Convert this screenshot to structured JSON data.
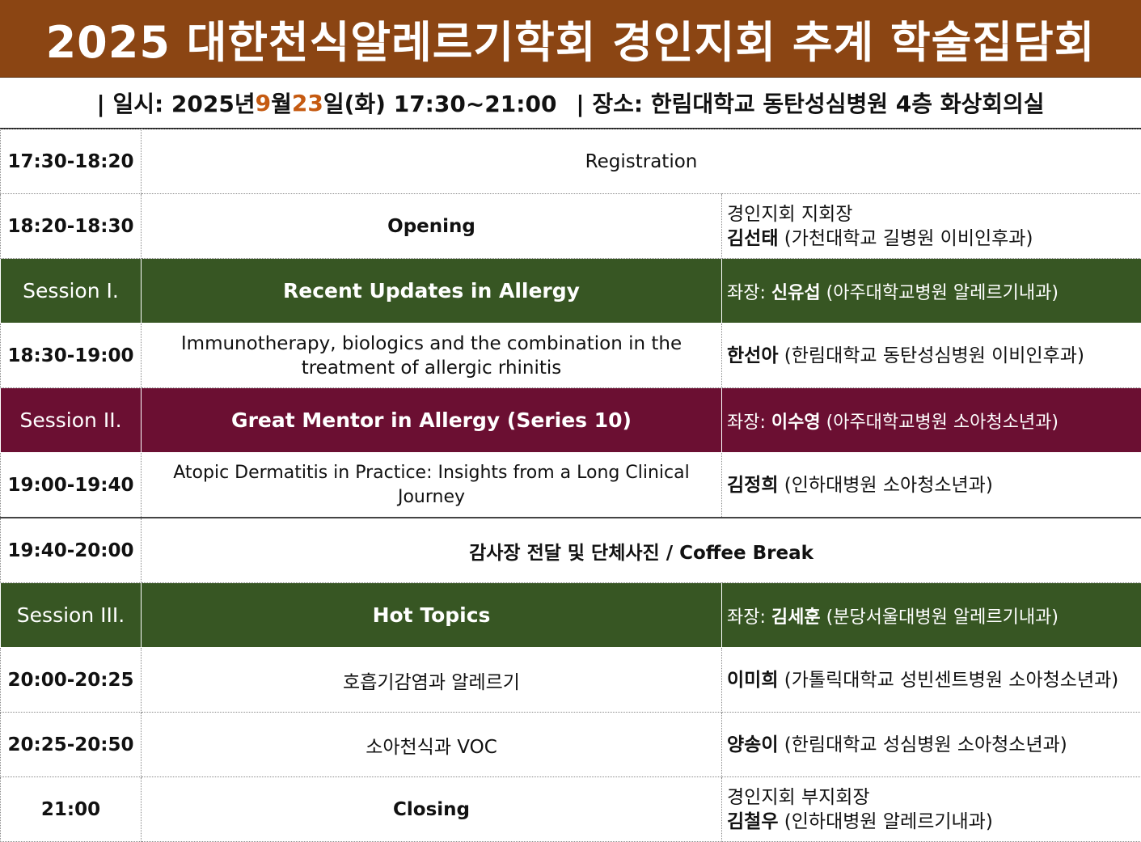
{
  "title": "2025 대한천식알레르기학회 경인지회 추계 학술집담회",
  "info": {
    "date_prefix": "| 일시: 2025년 ",
    "month": "9",
    "month_unit": "월 ",
    "day": "23",
    "day_rest": "일(화) 17:30~21:00",
    "venue": "| 장소: 한림대학교 동탄성심병원 4층 화상회의실"
  },
  "rows": [
    {
      "time": "17:30-18:20",
      "program": "Registration"
    },
    {
      "time": "18:20-18:30",
      "program": "Opening",
      "speaker_role": "경인지회 지회장",
      "speaker_name": "김선태",
      "speaker_affil": " (가천대학교 길병원 이비인후과)"
    },
    {
      "session": "Session I.",
      "title": "Recent Updates in Allergy",
      "chair_label": "좌장: ",
      "chair_name": "신유섭",
      "chair_affil": " (아주대학교병원 알레르기내과)",
      "color": "#375623"
    },
    {
      "time": "18:30-19:00",
      "program": "Immunotherapy, biologics and the combination in the treatment of allergic rhinitis",
      "speaker_name": "한선아",
      "speaker_affil": " (한림대학교 동탄성심병원 이비인후과)"
    },
    {
      "session": "Session II.",
      "title": "Great Mentor in Allergy (Series 10)",
      "chair_label": "좌장: ",
      "chair_name": "이수영",
      "chair_affil": " (아주대학교병원 소아청소년과)",
      "color": "#6b0f32"
    },
    {
      "time": "19:00-19:40",
      "program": "Atopic Dermatitis in Practice: Insights from a Long Clinical Journey",
      "speaker_name": "김정희",
      "speaker_affil": " (인하대병원 소아청소년과)"
    },
    {
      "time": "19:40-20:00",
      "program": "감사장 전달 및 단체사진 / Coffee Break"
    },
    {
      "session": "Session III.",
      "title": "Hot Topics",
      "chair_label": "좌장: ",
      "chair_name": "김세훈",
      "chair_affil": " (분당서울대병원 알레르기내과)",
      "color": "#375623"
    },
    {
      "time": "20:00-20:25",
      "program": "호흡기감염과 알레르기",
      "speaker_name": "이미희",
      "speaker_affil": " (가톨릭대학교 성빈센트병원 소아청소년과)"
    },
    {
      "time": "20:25-20:50",
      "program": "소아천식과 VOC",
      "speaker_name": "양송이",
      "speaker_affil": " (한림대학교 성심병원 소아청소년과)"
    },
    {
      "time": "21:00",
      "program": "Closing",
      "speaker_role": "경인지회 부지회장",
      "speaker_name": "김철우",
      "speaker_affil": " (인하대병원 알레르기내과)"
    }
  ],
  "colors": {
    "title_bg": "#8b4513",
    "session_green": "#375623",
    "session_purple": "#6b0f32",
    "accent": "#c55a11"
  }
}
